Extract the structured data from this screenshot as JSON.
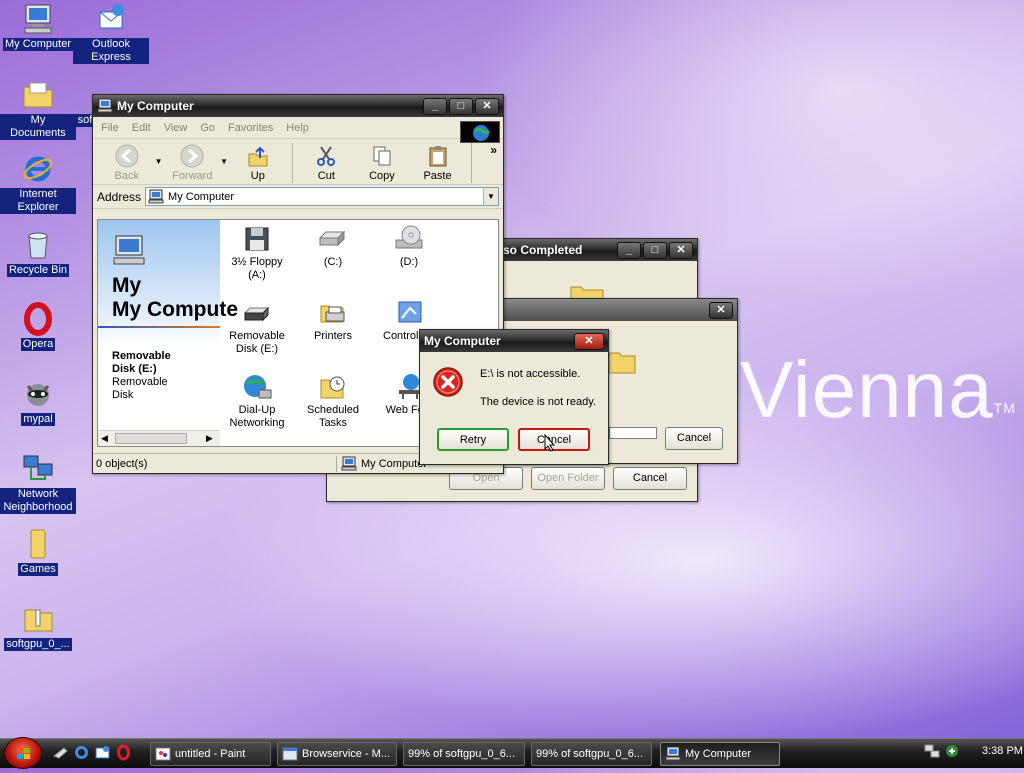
{
  "desktop": {
    "icons": [
      {
        "label": "My Computer",
        "icon": "computer-icon"
      },
      {
        "label": "Outlook Express",
        "icon": "outlook-icon"
      },
      {
        "label": "My Documents",
        "icon": "folder-icon"
      },
      {
        "label": "sof",
        "icon": "document-icon"
      },
      {
        "label": "Internet Explorer",
        "icon": "ie-icon"
      },
      {
        "label": "Recycle Bin",
        "icon": "recycle-bin-icon"
      },
      {
        "label": "Opera",
        "icon": "opera-icon"
      },
      {
        "label": "mypal",
        "icon": "mypal-icon"
      },
      {
        "label": "Network Neighborhood",
        "icon": "network-icon"
      },
      {
        "label": "Games",
        "icon": "folder-icon"
      },
      {
        "label": "softgpu_0_...",
        "icon": "zip-folder-icon"
      }
    ],
    "wallpaper_logo": "Vienna",
    "wallpaper_tm": "TM"
  },
  "mycomputer": {
    "title": "My Computer",
    "menu": [
      "File",
      "Edit",
      "View",
      "Go",
      "Favorites",
      "Help"
    ],
    "toolbar": {
      "back": "Back",
      "forward": "Forward",
      "up": "Up",
      "cut": "Cut",
      "copy": "Copy",
      "paste": "Paste",
      "more": "»"
    },
    "address_label": "Address",
    "address_value": "My Computer",
    "left_title": "My Compute",
    "left_title_line1": "My",
    "selected_name": "Removable Disk (E:)",
    "selected_type": "Removable Disk",
    "items": [
      {
        "label": "3½ Floppy (A:)",
        "icon": "floppy-icon"
      },
      {
        "label": "(C:)",
        "icon": "hard-drive-icon"
      },
      {
        "label": "(D:)",
        "icon": "cd-drive-icon"
      },
      {
        "label": "Removable Disk (E:)",
        "icon": "removable-disk-icon"
      },
      {
        "label": "Printers",
        "icon": "printer-icon"
      },
      {
        "label": "Control Pa",
        "icon": "control-panel-icon"
      },
      {
        "label": "Dial-Up Networking",
        "icon": "dialup-icon"
      },
      {
        "label": "Scheduled Tasks",
        "icon": "scheduled-tasks-icon"
      },
      {
        "label": "Web Fold",
        "icon": "web-folder-icon"
      }
    ],
    "status_count": "0 object(s)",
    "status_location": "My Computer"
  },
  "download_dialog": {
    "title": "so Completed",
    "open_label": "Open",
    "open_folder_label": "Open Folder",
    "cancel_label": "Cancel"
  },
  "progress_dialog": {
    "cancel_label": "Cancel"
  },
  "error_dialog": {
    "title": "My Computer",
    "message1": "E:\\ is not accessible.",
    "message2": "The device is not ready.",
    "retry_label": "Retry",
    "cancel_label": "Cancel"
  },
  "taskbar": {
    "tasks": [
      {
        "label": "untitled - Paint",
        "icon": "paint-icon"
      },
      {
        "label": "Browservice - M...",
        "icon": "browser-icon"
      },
      {
        "label": "99% of softgpu_0_6...",
        "icon": "download-icon"
      },
      {
        "label": "99% of softgpu_0_6...",
        "icon": "download-icon"
      },
      {
        "label": "My Computer",
        "icon": "computer-icon"
      }
    ],
    "clock": "3:38 PM"
  },
  "colors": {
    "selection": "#13237e",
    "accent_red": "#c21807",
    "retry_focus": "#2e9b2e"
  }
}
